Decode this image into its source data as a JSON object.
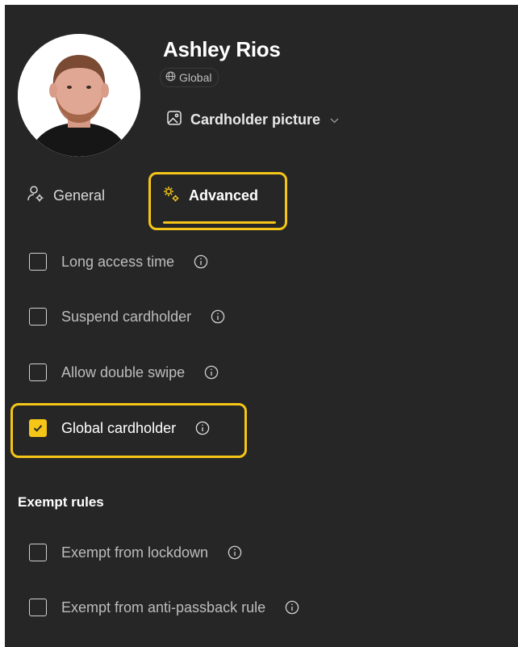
{
  "cardholder": {
    "name": "Ashley Rios",
    "scope_badge": "Global",
    "picture_select_label": "Cardholder picture"
  },
  "tabs": [
    {
      "label": "General",
      "icon": "person-gear-icon",
      "selected": false
    },
    {
      "label": "Advanced",
      "icon": "gears-icon",
      "selected": true
    }
  ],
  "options": [
    {
      "label": "Long access time",
      "checked": false
    },
    {
      "label": "Suspend cardholder",
      "checked": false
    },
    {
      "label": "Allow double swipe",
      "checked": false
    },
    {
      "label": "Global cardholder",
      "checked": true
    }
  ],
  "exempt_rules": {
    "heading": "Exempt rules",
    "items": [
      {
        "label": "Exempt from lockdown",
        "checked": false
      },
      {
        "label": "Exempt from anti-passback rule",
        "checked": false
      }
    ]
  },
  "colors": {
    "panel_background": "#262626",
    "accent": "#f5c518",
    "text_primary": "#ffffff",
    "text_secondary": "#bdbdbd"
  }
}
